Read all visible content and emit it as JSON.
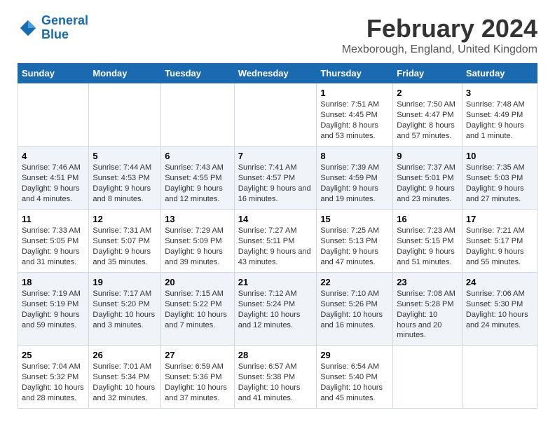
{
  "logo": {
    "line1": "General",
    "line2": "Blue"
  },
  "title": "February 2024",
  "subtitle": "Mexborough, England, United Kingdom",
  "weekdays": [
    "Sunday",
    "Monday",
    "Tuesday",
    "Wednesday",
    "Thursday",
    "Friday",
    "Saturday"
  ],
  "rows": [
    [
      {
        "day": "",
        "sunrise": "",
        "sunset": "",
        "daylight": ""
      },
      {
        "day": "",
        "sunrise": "",
        "sunset": "",
        "daylight": ""
      },
      {
        "day": "",
        "sunrise": "",
        "sunset": "",
        "daylight": ""
      },
      {
        "day": "",
        "sunrise": "",
        "sunset": "",
        "daylight": ""
      },
      {
        "day": "1",
        "sunrise": "7:51 AM",
        "sunset": "4:45 PM",
        "daylight": "8 hours and 53 minutes."
      },
      {
        "day": "2",
        "sunrise": "7:50 AM",
        "sunset": "4:47 PM",
        "daylight": "8 hours and 57 minutes."
      },
      {
        "day": "3",
        "sunrise": "7:48 AM",
        "sunset": "4:49 PM",
        "daylight": "9 hours and 1 minute."
      }
    ],
    [
      {
        "day": "4",
        "sunrise": "7:46 AM",
        "sunset": "4:51 PM",
        "daylight": "9 hours and 4 minutes."
      },
      {
        "day": "5",
        "sunrise": "7:44 AM",
        "sunset": "4:53 PM",
        "daylight": "9 hours and 8 minutes."
      },
      {
        "day": "6",
        "sunrise": "7:43 AM",
        "sunset": "4:55 PM",
        "daylight": "9 hours and 12 minutes."
      },
      {
        "day": "7",
        "sunrise": "7:41 AM",
        "sunset": "4:57 PM",
        "daylight": "9 hours and 16 minutes."
      },
      {
        "day": "8",
        "sunrise": "7:39 AM",
        "sunset": "4:59 PM",
        "daylight": "9 hours and 19 minutes."
      },
      {
        "day": "9",
        "sunrise": "7:37 AM",
        "sunset": "5:01 PM",
        "daylight": "9 hours and 23 minutes."
      },
      {
        "day": "10",
        "sunrise": "7:35 AM",
        "sunset": "5:03 PM",
        "daylight": "9 hours and 27 minutes."
      }
    ],
    [
      {
        "day": "11",
        "sunrise": "7:33 AM",
        "sunset": "5:05 PM",
        "daylight": "9 hours and 31 minutes."
      },
      {
        "day": "12",
        "sunrise": "7:31 AM",
        "sunset": "5:07 PM",
        "daylight": "9 hours and 35 minutes."
      },
      {
        "day": "13",
        "sunrise": "7:29 AM",
        "sunset": "5:09 PM",
        "daylight": "9 hours and 39 minutes."
      },
      {
        "day": "14",
        "sunrise": "7:27 AM",
        "sunset": "5:11 PM",
        "daylight": "9 hours and 43 minutes."
      },
      {
        "day": "15",
        "sunrise": "7:25 AM",
        "sunset": "5:13 PM",
        "daylight": "9 hours and 47 minutes."
      },
      {
        "day": "16",
        "sunrise": "7:23 AM",
        "sunset": "5:15 PM",
        "daylight": "9 hours and 51 minutes."
      },
      {
        "day": "17",
        "sunrise": "7:21 AM",
        "sunset": "5:17 PM",
        "daylight": "9 hours and 55 minutes."
      }
    ],
    [
      {
        "day": "18",
        "sunrise": "7:19 AM",
        "sunset": "5:19 PM",
        "daylight": "9 hours and 59 minutes."
      },
      {
        "day": "19",
        "sunrise": "7:17 AM",
        "sunset": "5:20 PM",
        "daylight": "10 hours and 3 minutes."
      },
      {
        "day": "20",
        "sunrise": "7:15 AM",
        "sunset": "5:22 PM",
        "daylight": "10 hours and 7 minutes."
      },
      {
        "day": "21",
        "sunrise": "7:12 AM",
        "sunset": "5:24 PM",
        "daylight": "10 hours and 12 minutes."
      },
      {
        "day": "22",
        "sunrise": "7:10 AM",
        "sunset": "5:26 PM",
        "daylight": "10 hours and 16 minutes."
      },
      {
        "day": "23",
        "sunrise": "7:08 AM",
        "sunset": "5:28 PM",
        "daylight": "10 hours and 20 minutes."
      },
      {
        "day": "24",
        "sunrise": "7:06 AM",
        "sunset": "5:30 PM",
        "daylight": "10 hours and 24 minutes."
      }
    ],
    [
      {
        "day": "25",
        "sunrise": "7:04 AM",
        "sunset": "5:32 PM",
        "daylight": "10 hours and 28 minutes."
      },
      {
        "day": "26",
        "sunrise": "7:01 AM",
        "sunset": "5:34 PM",
        "daylight": "10 hours and 32 minutes."
      },
      {
        "day": "27",
        "sunrise": "6:59 AM",
        "sunset": "5:36 PM",
        "daylight": "10 hours and 37 minutes."
      },
      {
        "day": "28",
        "sunrise": "6:57 AM",
        "sunset": "5:38 PM",
        "daylight": "10 hours and 41 minutes."
      },
      {
        "day": "29",
        "sunrise": "6:54 AM",
        "sunset": "5:40 PM",
        "daylight": "10 hours and 45 minutes."
      },
      {
        "day": "",
        "sunrise": "",
        "sunset": "",
        "daylight": ""
      },
      {
        "day": "",
        "sunrise": "",
        "sunset": "",
        "daylight": ""
      }
    ]
  ]
}
